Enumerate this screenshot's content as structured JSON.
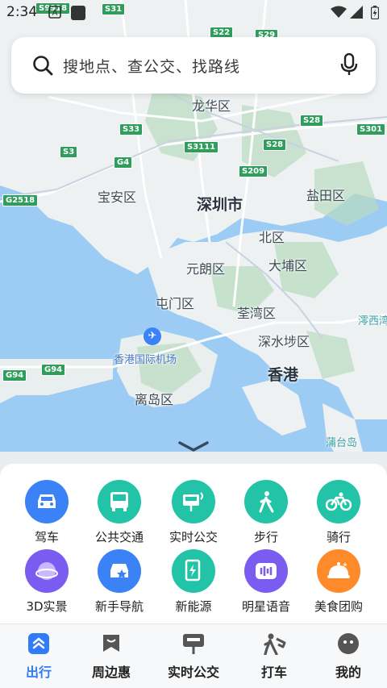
{
  "status": {
    "time": "2:34"
  },
  "search": {
    "placeholder": "搜地点、查公交、找路线"
  },
  "map": {
    "places": {
      "longhua": "龙华区",
      "baoan": "宝安区",
      "shenzhen": "深圳市",
      "yantian": "盐田区",
      "north": "北区",
      "yuenlong": "元朗区",
      "taipo": "大埔区",
      "tuenmun": "屯门区",
      "tsuenwan": "荃湾区",
      "ssp": "深水埗区",
      "sai": "澪西湾",
      "airport": "香港国际机场",
      "hongkong": "香港",
      "islands": "离岛区",
      "potoi": "蒲台岛"
    },
    "shields": {
      "s9918": "S9918",
      "s31": "S31",
      "s22": "S22",
      "s29": "S29",
      "s33": "S33",
      "s28a": "S28",
      "s301": "S301",
      "s3": "S3",
      "s3111": "S3111",
      "s28b": "S28",
      "g4": "G4",
      "s209": "S209",
      "g2518": "G2518",
      "g94a": "G94",
      "g94b": "G94"
    }
  },
  "services": [
    {
      "label": "驾车",
      "icon": "car-icon",
      "color": "#3b82f6"
    },
    {
      "label": "公共交通",
      "icon": "bus-icon",
      "color": "#22c3a6"
    },
    {
      "label": "实时公交",
      "icon": "realtime-bus-icon",
      "color": "#22c3a6"
    },
    {
      "label": "步行",
      "icon": "walk-icon",
      "color": "#22c3a6"
    },
    {
      "label": "骑行",
      "icon": "bike-icon",
      "color": "#22c3a6"
    },
    {
      "label": "3D实景",
      "icon": "globe-3d-icon",
      "color": "#7b5cf0"
    },
    {
      "label": "新手导航",
      "icon": "novice-nav-icon",
      "color": "#3b82f6"
    },
    {
      "label": "新能源",
      "icon": "charging-icon",
      "color": "#22c3a6"
    },
    {
      "label": "明星语音",
      "icon": "voice-icon",
      "color": "#7b5cf0"
    },
    {
      "label": "美食团购",
      "icon": "food-icon",
      "color": "#ff8a2a"
    }
  ],
  "tabs": [
    {
      "label": "出行",
      "icon": "travel-icon"
    },
    {
      "label": "周边惠",
      "icon": "nearby-deals-icon"
    },
    {
      "label": "实时公交",
      "icon": "bus-stop-icon"
    },
    {
      "label": "打车",
      "icon": "taxi-icon"
    },
    {
      "label": "我的",
      "icon": "profile-icon"
    }
  ]
}
